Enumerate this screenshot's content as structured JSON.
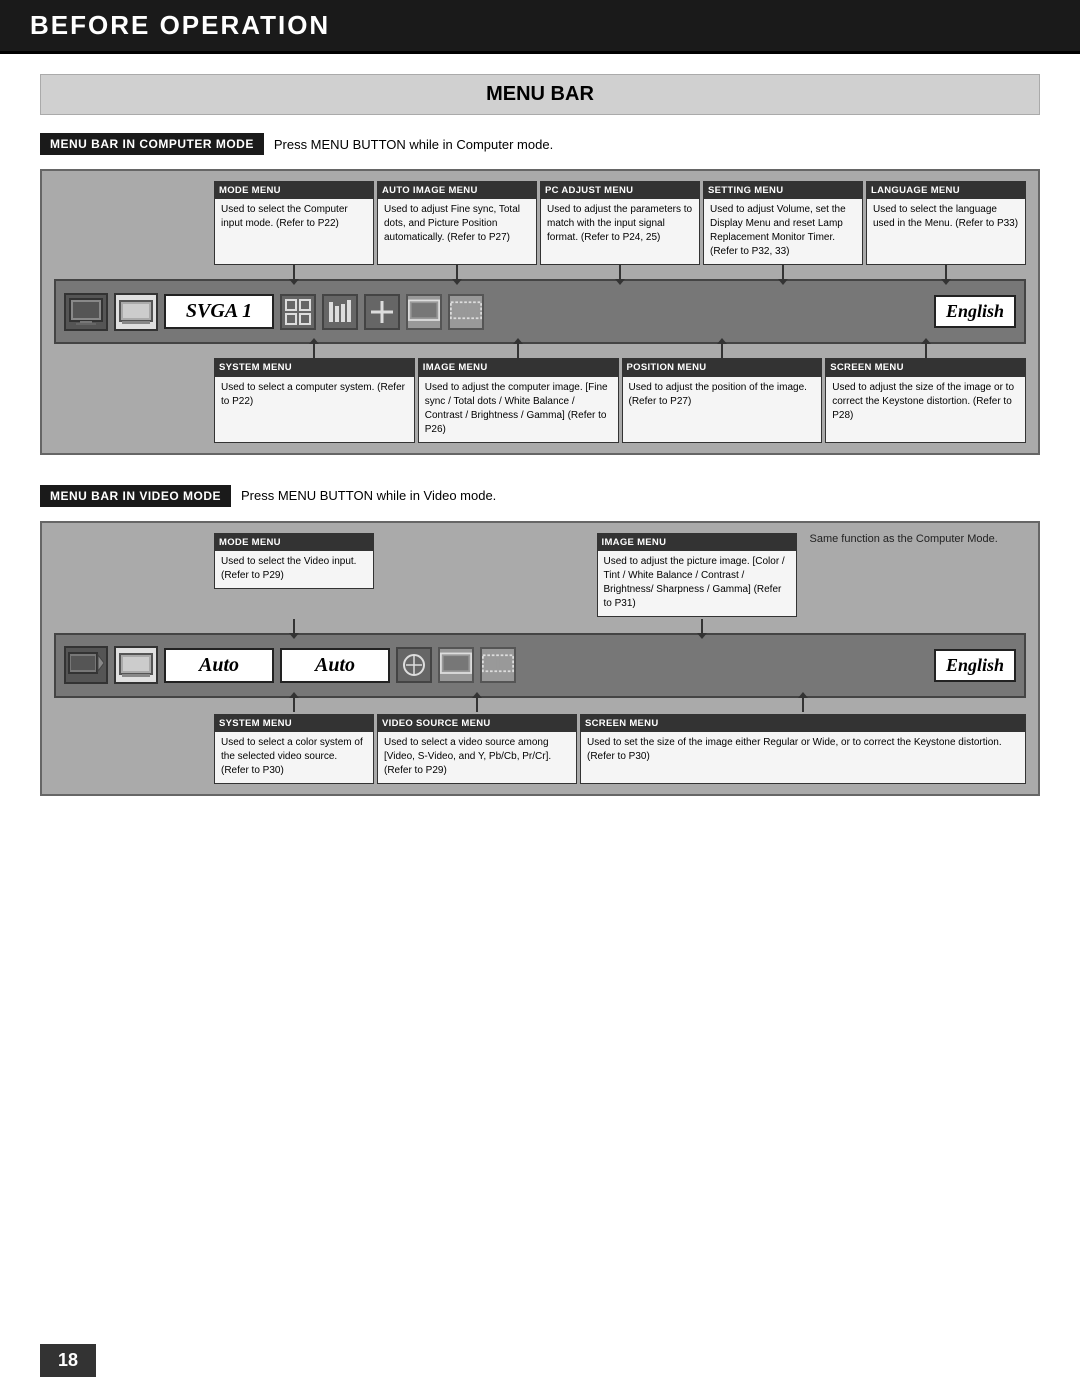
{
  "header": {
    "title": "BEFORE OPERATION"
  },
  "page": {
    "number": "18"
  },
  "section_title": "MENU BAR",
  "computer_mode": {
    "badge": "MENU BAR IN COMPUTER MODE",
    "description": "Press MENU BUTTON while in Computer mode.",
    "top_items": [
      {
        "title": "MODE MENU",
        "text": "Used to select the Computer input mode. (Refer to P22)"
      },
      {
        "title": "AUTO IMAGE MENU",
        "text": "Used to adjust Fine sync, Total dots, and Picture Position automatically. (Refer to P27)"
      },
      {
        "title": "PC ADJUST MENU",
        "text": "Used to adjust the parameters to match with the input signal format. (Refer to P24, 25)"
      },
      {
        "title": "SETTING MENU",
        "text": "Used to adjust Volume, set the Display Menu and reset Lamp Replacement Monitor Timer. (Refer to P32, 33)"
      },
      {
        "title": "LANGUAGE MENU",
        "text": "Used to select the language used in the Menu. (Refer to P33)"
      }
    ],
    "bar": {
      "label": "SVGA 1",
      "english": "English"
    },
    "bottom_items": [
      {
        "title": "SYSTEM MENU",
        "text": "Used to select a computer system. (Refer to P22)"
      },
      {
        "title": "IMAGE MENU",
        "text": "Used to adjust the computer image. [Fine sync / Total dots / White Balance / Contrast / Brightness / Gamma] (Refer to P26)"
      },
      {
        "title": "POSITION MENU",
        "text": "Used to adjust the position of the image. (Refer to P27)"
      },
      {
        "title": "SCREEN MENU",
        "text": "Used to adjust the size of the image or to correct the Keystone distortion. (Refer to P28)"
      }
    ]
  },
  "video_mode": {
    "badge": "MENU BAR IN VIDEO MODE",
    "description": "Press MENU BUTTON while in Video mode.",
    "top_items": [
      {
        "title": "MODE MENU",
        "text": "Used to select the Video input. (Refer to P29)"
      },
      {
        "title": "IMAGE MENU",
        "text": "Used to adjust the picture image. [Color / Tint / White Balance / Contrast / Brightness/ Sharpness / Gamma] (Refer to P31)"
      }
    ],
    "note": "Same function as the Computer Mode.",
    "bar": {
      "label1": "Auto",
      "label2": "Auto",
      "english": "English"
    },
    "bottom_items": [
      {
        "title": "SYSTEM MENU",
        "text": "Used to select a color system of the selected video source. (Refer to P30)"
      },
      {
        "title": "VIDEO SOURCE MENU",
        "text": "Used to select a video source among [Video, S-Video, and Y, Pb/Cb, Pr/Cr]. (Refer to P29)"
      },
      {
        "title": "SCREEN MENU",
        "text": "Used to set the size of the image either Regular or Wide, or to correct the Keystone distortion. (Refer to P30)"
      }
    ]
  }
}
